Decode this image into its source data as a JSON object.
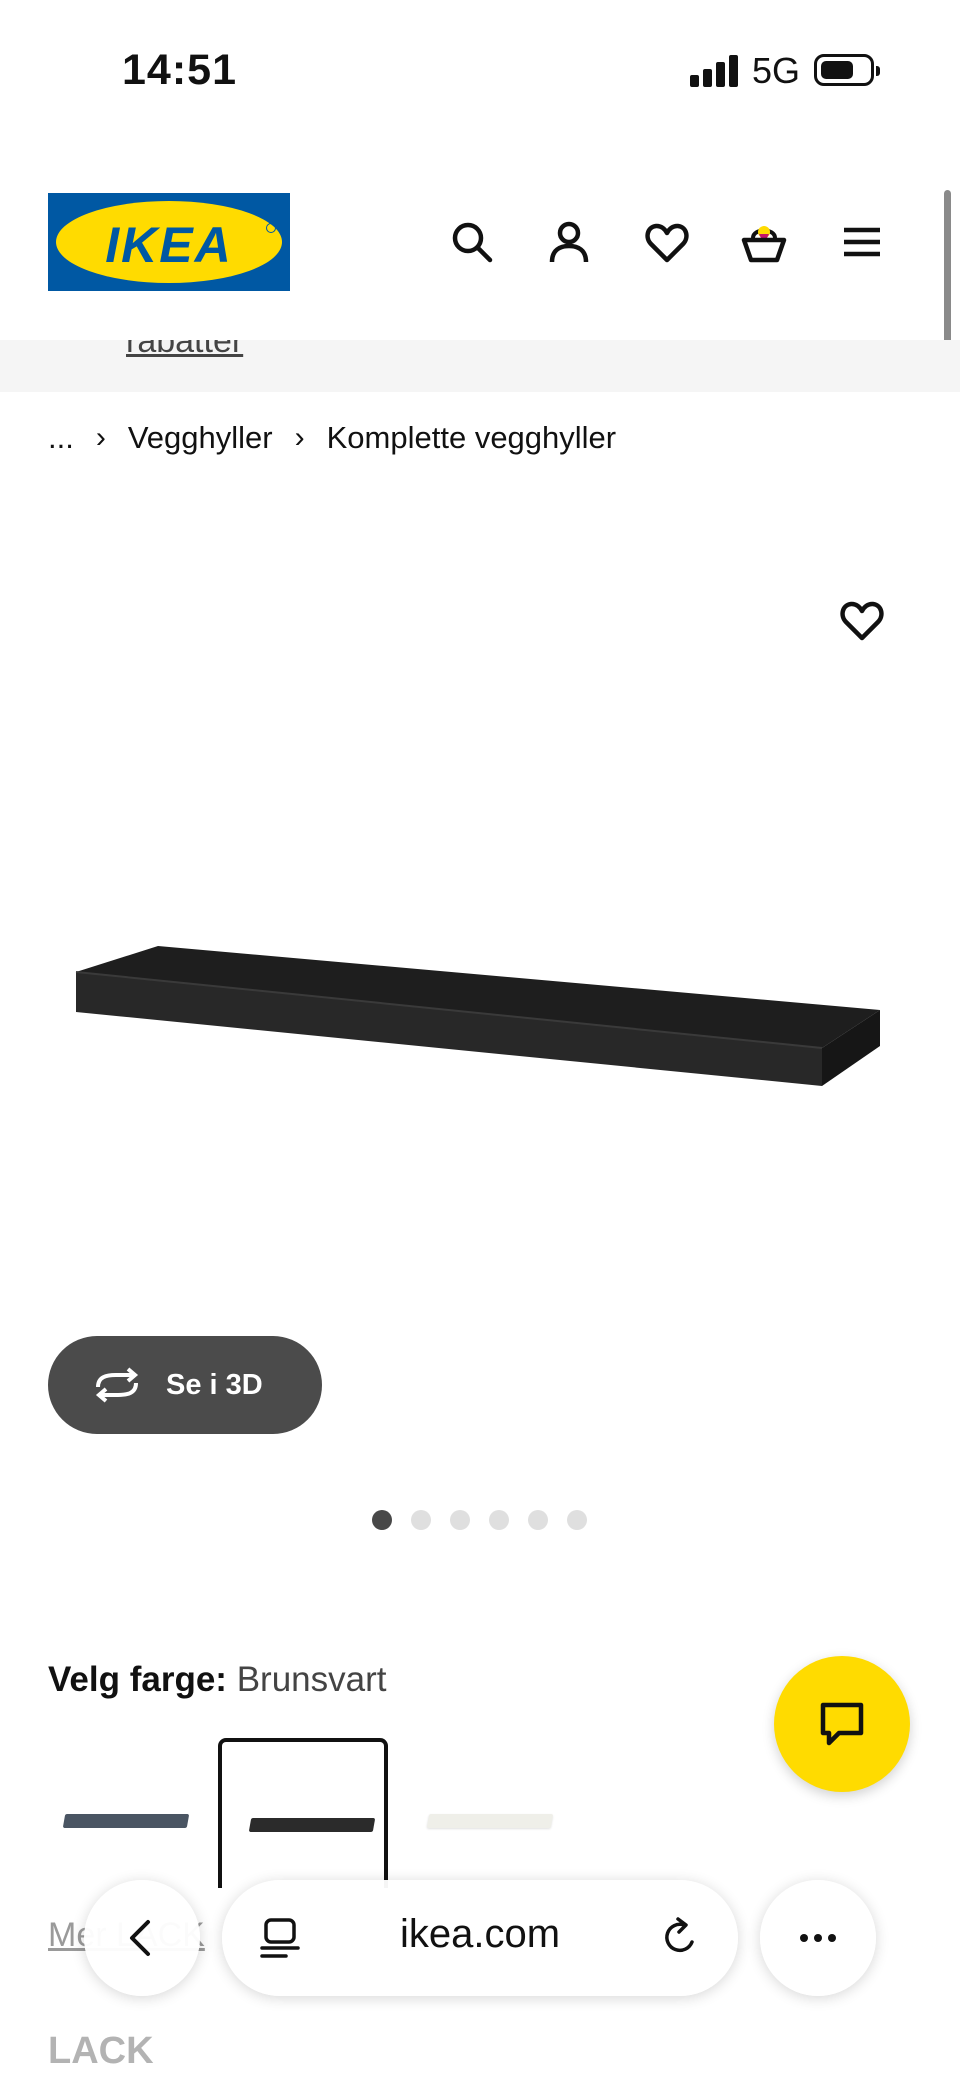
{
  "status_bar": {
    "time": "14:51",
    "network": "5G"
  },
  "header": {
    "logo_text": "IKEA"
  },
  "promo": {
    "link_text": "rabatter"
  },
  "breadcrumb": {
    "ellipsis": "...",
    "items": [
      "Vegghyller",
      "Komplette vegghyller"
    ]
  },
  "product": {
    "view_3d_label": "Se i 3D",
    "image_count": 6,
    "active_image": 1,
    "color_label": "Velg farge:",
    "color_value": "Brunsvart",
    "swatch_colors": [
      "#4a5563",
      "#2b2b2b",
      "#efefe9"
    ],
    "series_link": "Mer LACK",
    "name": "LACK"
  },
  "browser": {
    "url": "ikea.com"
  },
  "colors": {
    "ikea_blue": "#0058a3",
    "ikea_yellow": "#ffdb00",
    "button_dark": "#4b4b4b"
  }
}
